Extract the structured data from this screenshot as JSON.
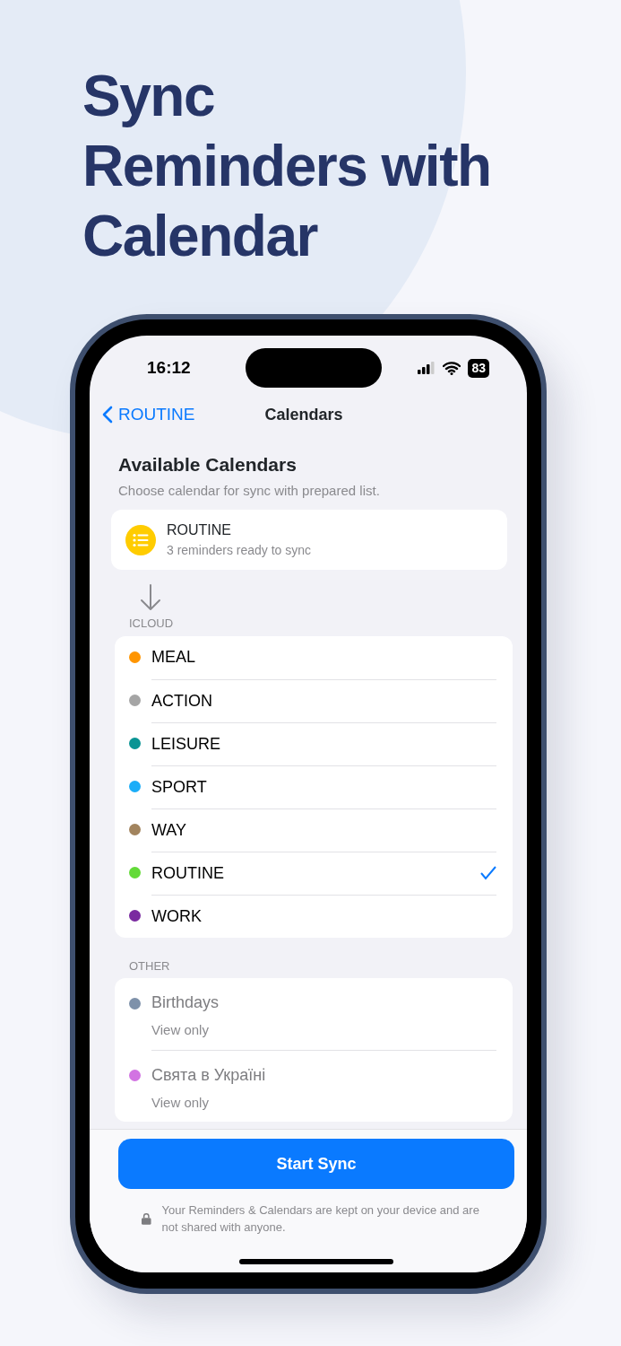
{
  "headline_lines": [
    "Sync",
    "Reminders with",
    "Calendar"
  ],
  "status_bar": {
    "time": "16:12",
    "battery": "83"
  },
  "nav": {
    "back": "ROUTINE",
    "title": "Calendars"
  },
  "heading": "Available Calendars",
  "subheading": "Choose calendar for sync with prepared list.",
  "source": {
    "title": "ROUTINE",
    "subtitle": "3 reminders ready to sync"
  },
  "groups": [
    {
      "label": "ICLOUD",
      "items": [
        {
          "name": "MEAL",
          "color": "#ff9500",
          "selected": false,
          "disabled": false
        },
        {
          "name": "ACTION",
          "color": "#a5a5a5",
          "selected": false,
          "disabled": false
        },
        {
          "name": "LEISURE",
          "color": "#0a9494",
          "selected": false,
          "disabled": false
        },
        {
          "name": "SPORT",
          "color": "#1badf8",
          "selected": false,
          "disabled": false
        },
        {
          "name": "WAY",
          "color": "#a2845e",
          "selected": false,
          "disabled": false
        },
        {
          "name": "ROUTINE",
          "color": "#63da38",
          "selected": true,
          "disabled": false
        },
        {
          "name": "WORK",
          "color": "#7a2aa0",
          "selected": false,
          "disabled": false
        }
      ]
    },
    {
      "label": "OTHER",
      "items": [
        {
          "name": "Birthdays",
          "detail": "View only",
          "color": "#7e91aa",
          "selected": false,
          "disabled": true
        },
        {
          "name": "Свята в Україні",
          "detail": "View only",
          "color": "#d273e2",
          "selected": false,
          "disabled": true
        }
      ]
    }
  ],
  "button": "Start Sync",
  "note": "Your Reminders & Calendars are kept on your device and are not shared with anyone."
}
